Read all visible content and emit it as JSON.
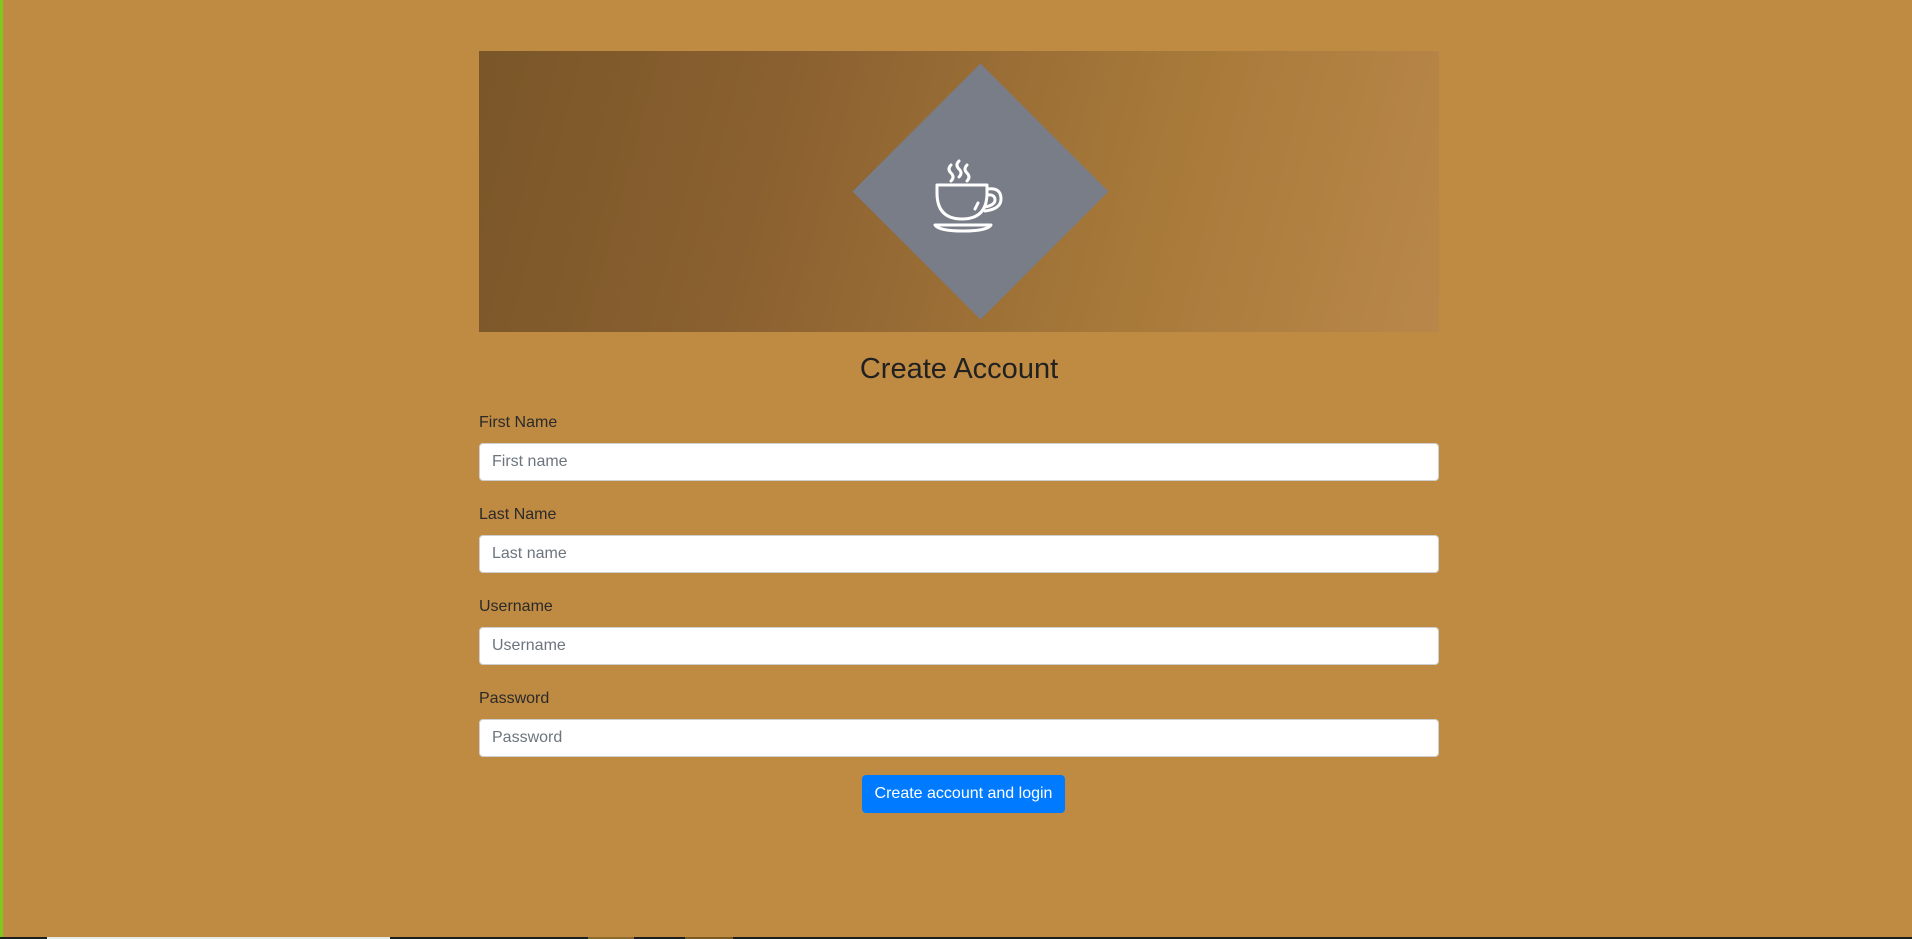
{
  "page": {
    "title": "Create Account"
  },
  "banner": {
    "icon": "coffee-cup-icon"
  },
  "form": {
    "fields": [
      {
        "label": "First Name",
        "placeholder": "First name",
        "value": ""
      },
      {
        "label": "Last Name",
        "placeholder": "Last name",
        "value": ""
      },
      {
        "label": "Username",
        "placeholder": "Username",
        "value": ""
      },
      {
        "label": "Password",
        "placeholder": "Password",
        "value": ""
      }
    ],
    "submit_label": "Create account and login"
  },
  "colors": {
    "background": "#BF8A42",
    "diamond": "#787D88",
    "button": "#007BFF"
  }
}
